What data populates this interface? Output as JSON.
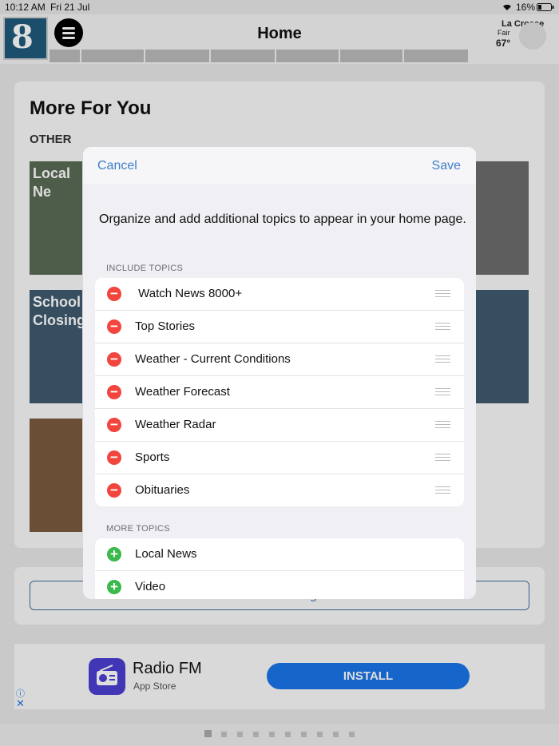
{
  "status_bar": {
    "time": "10:12 AM",
    "date": "Fri 21 Jul",
    "battery": "16%"
  },
  "header": {
    "title": "Home",
    "logo_text": "8"
  },
  "weather": {
    "city": "La Crosse",
    "condition": "Fair",
    "temp": "67°"
  },
  "page": {
    "section_title": "More For You",
    "category": "OTHER",
    "tiles": [
      "Local Ne",
      "School\nClosings",
      ""
    ],
    "customize_label": "Customize Page"
  },
  "ad": {
    "app_name": "Radio FM",
    "store": "App Store",
    "install_label": "INSTALL",
    "info_icon": "ⓘ",
    "close_icon": "✕"
  },
  "modal": {
    "cancel_label": "Cancel",
    "save_label": "Save",
    "intro": "Organize and add additional topics to appear in your home page.",
    "include_label": "INCLUDE TOPICS",
    "include_topics": [
      " Watch News 8000+",
      "Top Stories",
      "Weather - Current Conditions",
      "Weather Forecast",
      "Weather Radar",
      "Sports",
      "Obituaries"
    ],
    "more_label": "MORE TOPICS",
    "more_topics": [
      "Local News",
      "Video"
    ]
  },
  "colors": {
    "accent": "#3e7ec8",
    "remove": "#f2453d",
    "add": "#3bb94c"
  }
}
